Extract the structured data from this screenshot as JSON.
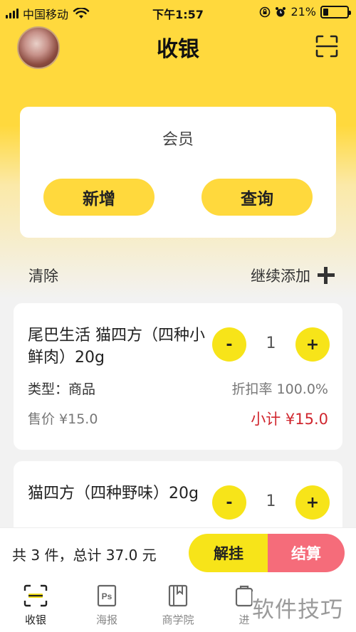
{
  "status_bar": {
    "carrier": "中国移动",
    "time": "下午1:57",
    "battery": "21%",
    "battery_level": 0.21
  },
  "header": {
    "title": "收银"
  },
  "member": {
    "title": "会员",
    "add_label": "新增",
    "query_label": "查询"
  },
  "actions": {
    "clear_label": "清除",
    "continue_label": "继续添加"
  },
  "products": [
    {
      "name": "尾巴生活 猫四方（四种小鲜肉）20g",
      "qty": "1",
      "type": "类型：商品",
      "discount": "折扣率 100.0%",
      "price": "售价 ¥15.0",
      "subtotal": "小计 ¥15.0"
    },
    {
      "name": "猫四方（四种野味）20g",
      "qty": "1"
    }
  ],
  "qty_controls": {
    "minus": "-",
    "plus": "+"
  },
  "checkout": {
    "total": "共 3 件，总计 37.0 元",
    "suspend_label": "解挂",
    "pay_label": "结算"
  },
  "tabs": [
    {
      "label": "收银",
      "icon": "cashier-icon"
    },
    {
      "label": "海报",
      "icon": "poster-ps-icon"
    },
    {
      "label": "商学院",
      "icon": "book-icon"
    },
    {
      "label": "进",
      "icon": "purchase-icon"
    }
  ],
  "watermark": "软件技巧",
  "colors": {
    "accent_yellow": "#ffd93d",
    "button_yellow": "#f7e419",
    "pay_pink": "#f56c7a",
    "subtotal_red": "#d0262e"
  }
}
